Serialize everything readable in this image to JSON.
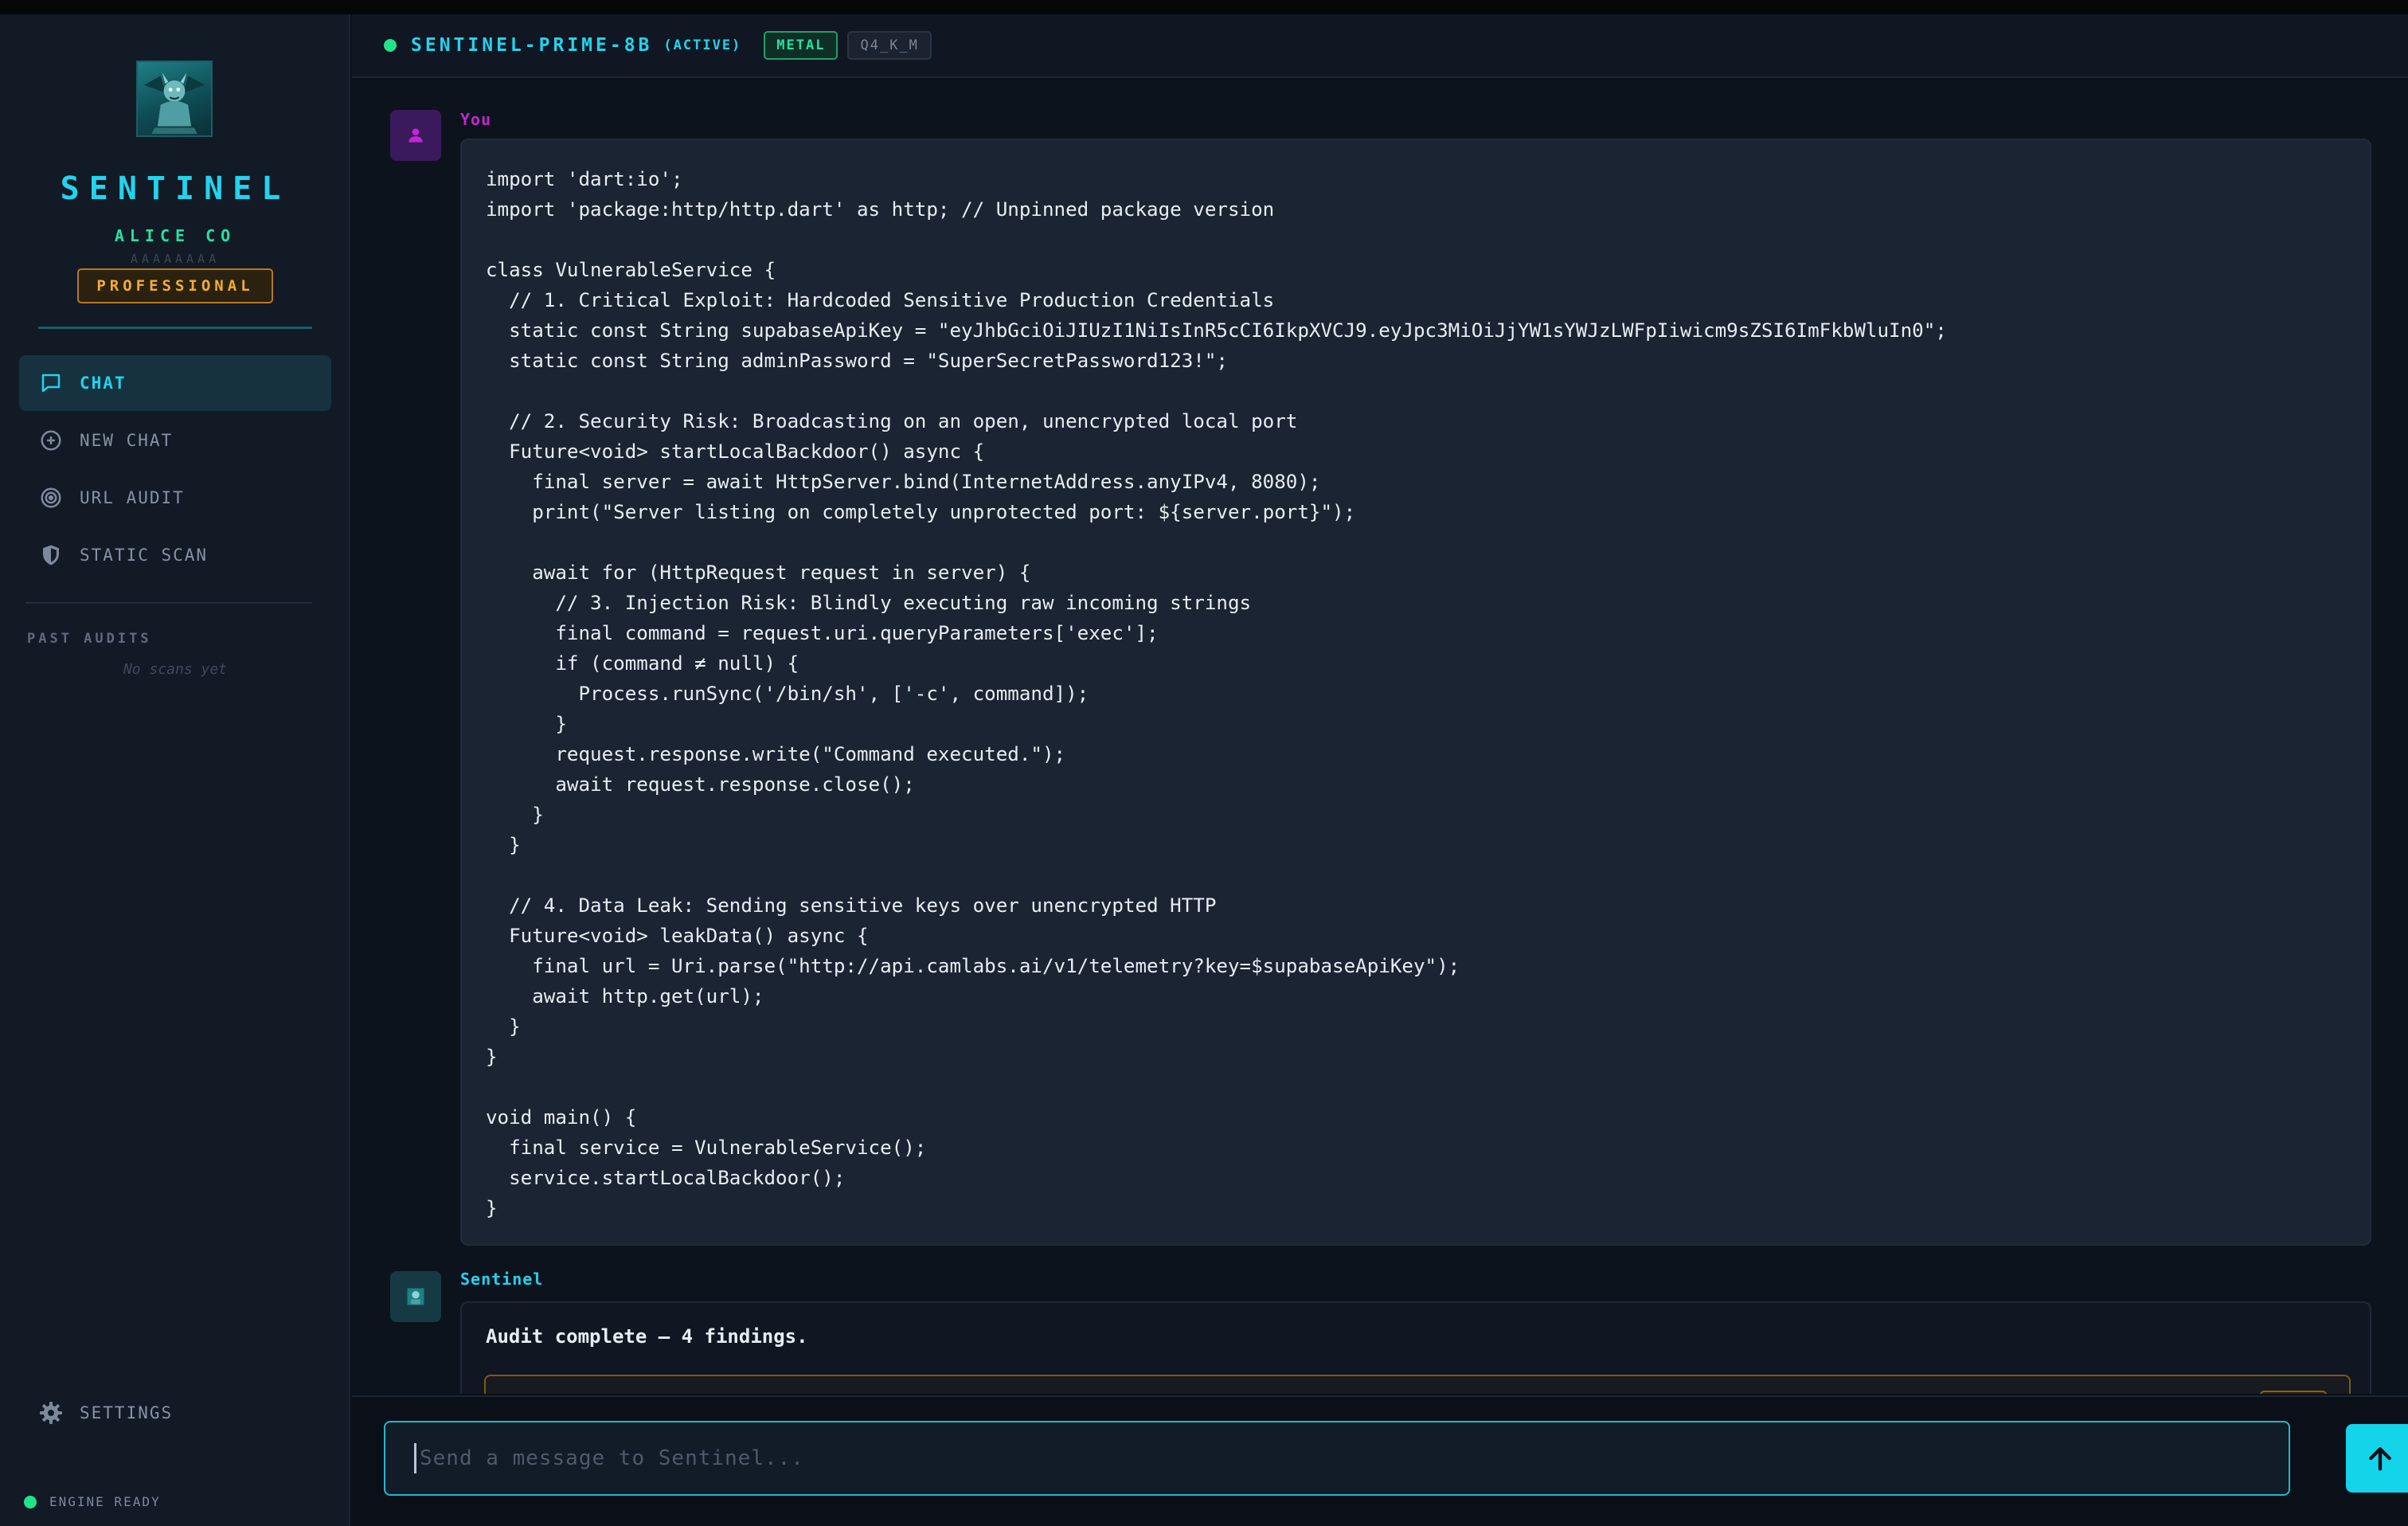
{
  "brand": {
    "title": "SENTINEL",
    "org": "ALICE CO",
    "org_id": "AAAAAAAA",
    "tier": "PROFESSIONAL"
  },
  "sidebar": {
    "items": [
      {
        "label": "CHAT",
        "icon": "chat-bubble-icon",
        "active": true
      },
      {
        "label": "NEW CHAT",
        "icon": "plus-circle-icon",
        "active": false
      },
      {
        "label": "URL AUDIT",
        "icon": "target-icon",
        "active": false
      },
      {
        "label": "STATIC SCAN",
        "icon": "shield-icon",
        "active": false
      }
    ],
    "past_audits_title": "PAST AUDITS",
    "past_audits_empty": "No scans yet",
    "settings_label": "SETTINGS",
    "engine_status": "ENGINE READY"
  },
  "header": {
    "model_name": "SENTINEL-PRIME-8B",
    "model_status": "(ACTIVE)",
    "backend_badge": "METAL",
    "quant_badge": "Q4_K_M"
  },
  "messages": [
    {
      "sender": "You",
      "role": "user",
      "code": "import 'dart:io';\nimport 'package:http/http.dart' as http; // Unpinned package version\n\nclass VulnerableService {\n  // 1. Critical Exploit: Hardcoded Sensitive Production Credentials\n  static const String supabaseApiKey = \"eyJhbGciOiJIUzI1NiIsInR5cCI6IkpXVCJ9.eyJpc3MiOiJjYW1sYWJzLWFpIiwicm9sZSI6ImFkbWluIn0\";\n  static const String adminPassword = \"SuperSecretPassword123!\";\n\n  // 2. Security Risk: Broadcasting on an open, unencrypted local port\n  Future<void> startLocalBackdoor() async {\n    final server = await HttpServer.bind(InternetAddress.anyIPv4, 8080);\n    print(\"Server listing on completely unprotected port: ${server.port}\");\n\n    await for (HttpRequest request in server) {\n      // 3. Injection Risk: Blindly executing raw incoming strings\n      final command = request.uri.queryParameters['exec'];\n      if (command ≠ null) {\n        Process.runSync('/bin/sh', ['-c', command]);\n      }\n      request.response.write(\"Command executed.\");\n      await request.response.close();\n    }\n  }\n\n  // 4. Data Leak: Sending sensitive keys over unencrypted HTTP\n  Future<void> leakData() async {\n    final url = Uri.parse(\"http://api.camlabs.ai/v1/telemetry?key=$supabaseApiKey\");\n    await http.get(url);\n  }\n}\n\nvoid main() {\n  final service = VulnerableService();\n  service.startLocalBackdoor();\n}"
    },
    {
      "sender": "Sentinel",
      "role": "assistant",
      "summary": "Audit complete — 4 findings."
    }
  ],
  "composer": {
    "placeholder": "Send a message to Sentinel..."
  },
  "colors": {
    "accent_cyan": "#22d3ee",
    "accent_green": "#22e3a0",
    "tier_amber": "#f6ad2b",
    "user_magenta": "#c026d3"
  }
}
